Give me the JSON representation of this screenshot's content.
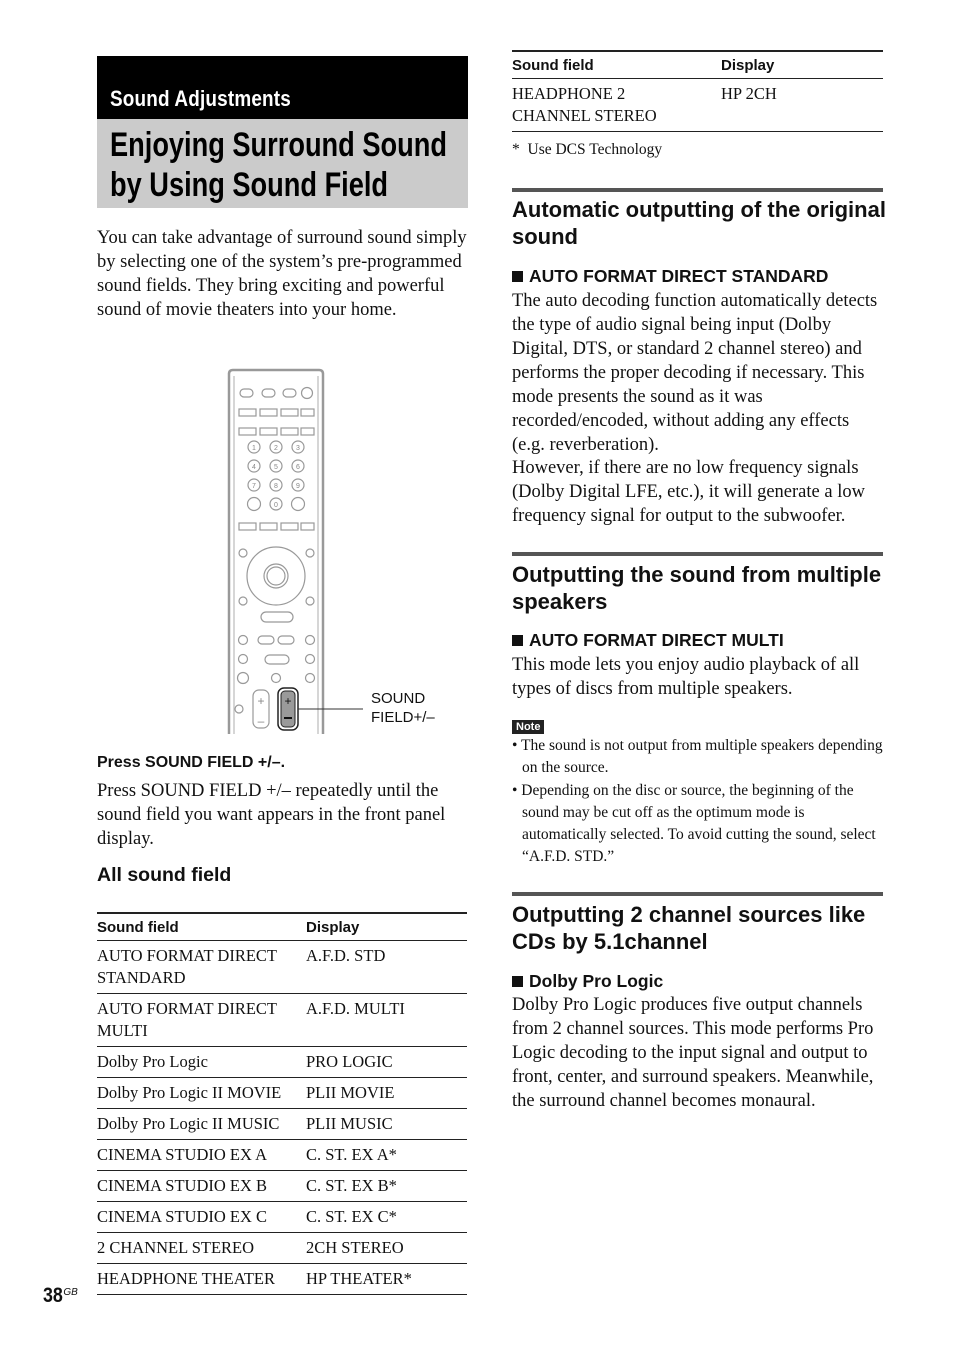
{
  "header": {
    "section": "Sound Adjustments",
    "title_line1": "Enjoying Surround Sound",
    "title_line2": "by Using Sound Field"
  },
  "intro": "You can take advantage of surround sound simply by selecting one of the system’s pre-programmed sound fields. They bring exciting and powerful sound of movie theaters into your home.",
  "remote": {
    "callout_line1": "SOUND",
    "callout_line2": "FIELD+/–",
    "number_keys": [
      "1",
      "2",
      "3",
      "4",
      "5",
      "6",
      "7",
      "8",
      "9",
      "",
      "0",
      ""
    ]
  },
  "step": {
    "heading": "Press SOUND FIELD +/–.",
    "text": "Press SOUND FIELD +/– repeatedly until the sound field you want appears in the front panel display."
  },
  "all_sound_field": {
    "heading": "All sound field",
    "columns": [
      "Sound field",
      "Display"
    ],
    "rows": [
      [
        "AUTO FORMAT DIRECT STANDARD",
        "A.F.D. STD"
      ],
      [
        "AUTO FORMAT DIRECT MULTI",
        "A.F.D. MULTI"
      ],
      [
        "Dolby Pro Logic",
        "PRO LOGIC"
      ],
      [
        "Dolby Pro Logic II MOVIE",
        "PLII MOVIE"
      ],
      [
        "Dolby Pro Logic II MUSIC",
        "PLII MUSIC"
      ],
      [
        "CINEMA STUDIO EX A",
        "C. ST. EX A*"
      ],
      [
        "CINEMA STUDIO EX B",
        "C. ST. EX B*"
      ],
      [
        "CINEMA STUDIO EX C",
        "C. ST. EX C*"
      ],
      [
        "2 CHANNEL STEREO",
        "2CH STEREO"
      ],
      [
        "HEADPHONE THEATER",
        "HP THEATER*"
      ]
    ]
  },
  "cont_table": {
    "columns": [
      "Sound field",
      "Display"
    ],
    "rows": [
      [
        "HEADPHONE 2 CHANNEL STEREO",
        "HP 2CH"
      ]
    ],
    "footnote": "*  Use DCS Technology"
  },
  "sections": [
    {
      "heading": "Automatic outputting of the original sound",
      "subheading": "AUTO FORMAT DIRECT STANDARD",
      "text": "The auto decoding function automatically detects the type of audio signal being input (Dolby Digital, DTS, or standard 2 channel stereo) and performs the proper decoding if necessary. This mode presents the sound as it was recorded/encoded, without adding any effects (e.g. reverberation).",
      "text2": "However, if there are no low frequency signals (Dolby Digital LFE, etc.), it will generate a low frequency signal for output to the subwoofer."
    },
    {
      "heading": "Outputting the sound from multiple speakers",
      "subheading": "AUTO FORMAT DIRECT MULTI",
      "text": "This mode lets you enjoy audio playback of all types of discs from multiple speakers."
    },
    {
      "heading": "Outputting 2 channel sources like CDs by 5.1channel",
      "subheading": "Dolby Pro Logic",
      "text": "Dolby Pro Logic produces five output channels from 2 channel sources. This mode performs Pro Logic decoding to the input signal and output to front, center, and surround speakers. Meanwhile, the surround channel becomes monaural."
    }
  ],
  "note": {
    "label": "Note",
    "items": [
      "• The sound is not output from multiple speakers depending on the source.",
      "• Depending on the disc or source, the beginning of the sound may be cut off as the optimum mode is automatically selected. To avoid cutting the sound, select “A.F.D. STD.”"
    ]
  },
  "footer": {
    "page_number": "38",
    "page_suffix": "GB"
  }
}
